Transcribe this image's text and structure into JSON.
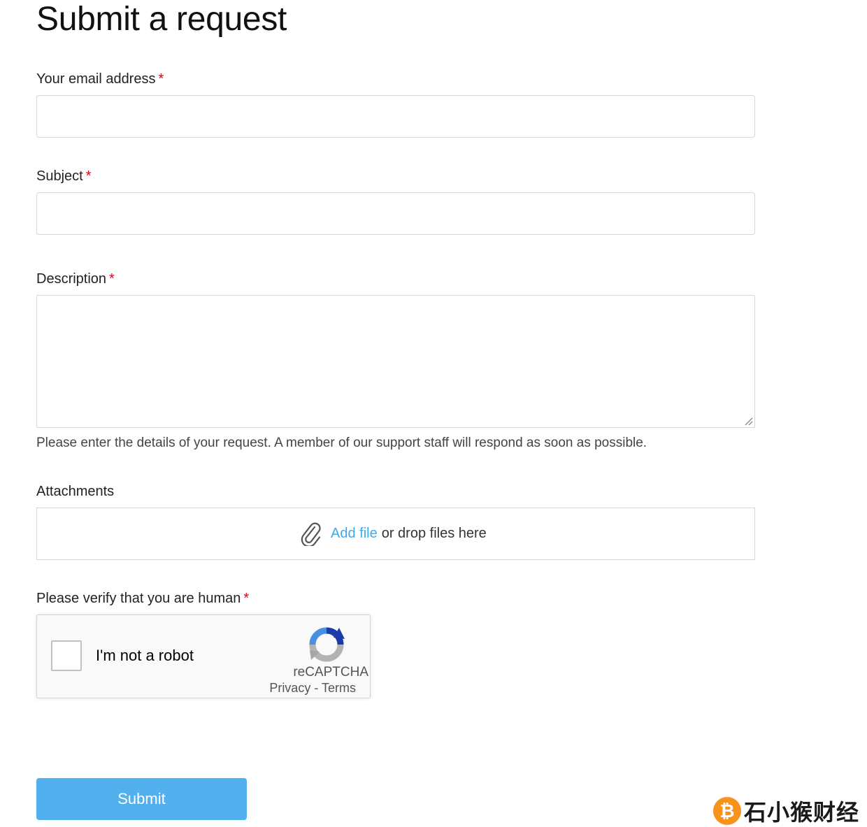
{
  "page": {
    "title": "Submit a request"
  },
  "fields": {
    "email": {
      "label": "Your email address",
      "required_mark": "*",
      "value": "",
      "placeholder": ""
    },
    "subject": {
      "label": "Subject",
      "required_mark": "*",
      "value": "",
      "placeholder": ""
    },
    "description": {
      "label": "Description",
      "required_mark": "*",
      "value": "",
      "hint": "Please enter the details of your request. A member of our support staff will respond as soon as possible."
    },
    "attachments": {
      "label": "Attachments",
      "add_file_link": "Add file",
      "drop_text": "or drop files here",
      "icon": "paperclip-icon"
    },
    "verify": {
      "label": "Please verify that you are human",
      "required_mark": "*",
      "checkbox_label": "I'm not a robot",
      "brand": "reCAPTCHA",
      "privacy_link": "Privacy",
      "separator": " - ",
      "terms_link": "Terms",
      "icon": "recaptcha-logo-icon"
    }
  },
  "actions": {
    "submit_label": "Submit"
  },
  "watermark": {
    "coin_symbol": "₿",
    "text": "石小猴财经"
  },
  "colors": {
    "accent": "#52b0ee",
    "link": "#3ea9e8",
    "required": "#e0001b",
    "border": "#d6d6d6",
    "watermark_coin": "#f7931a"
  }
}
